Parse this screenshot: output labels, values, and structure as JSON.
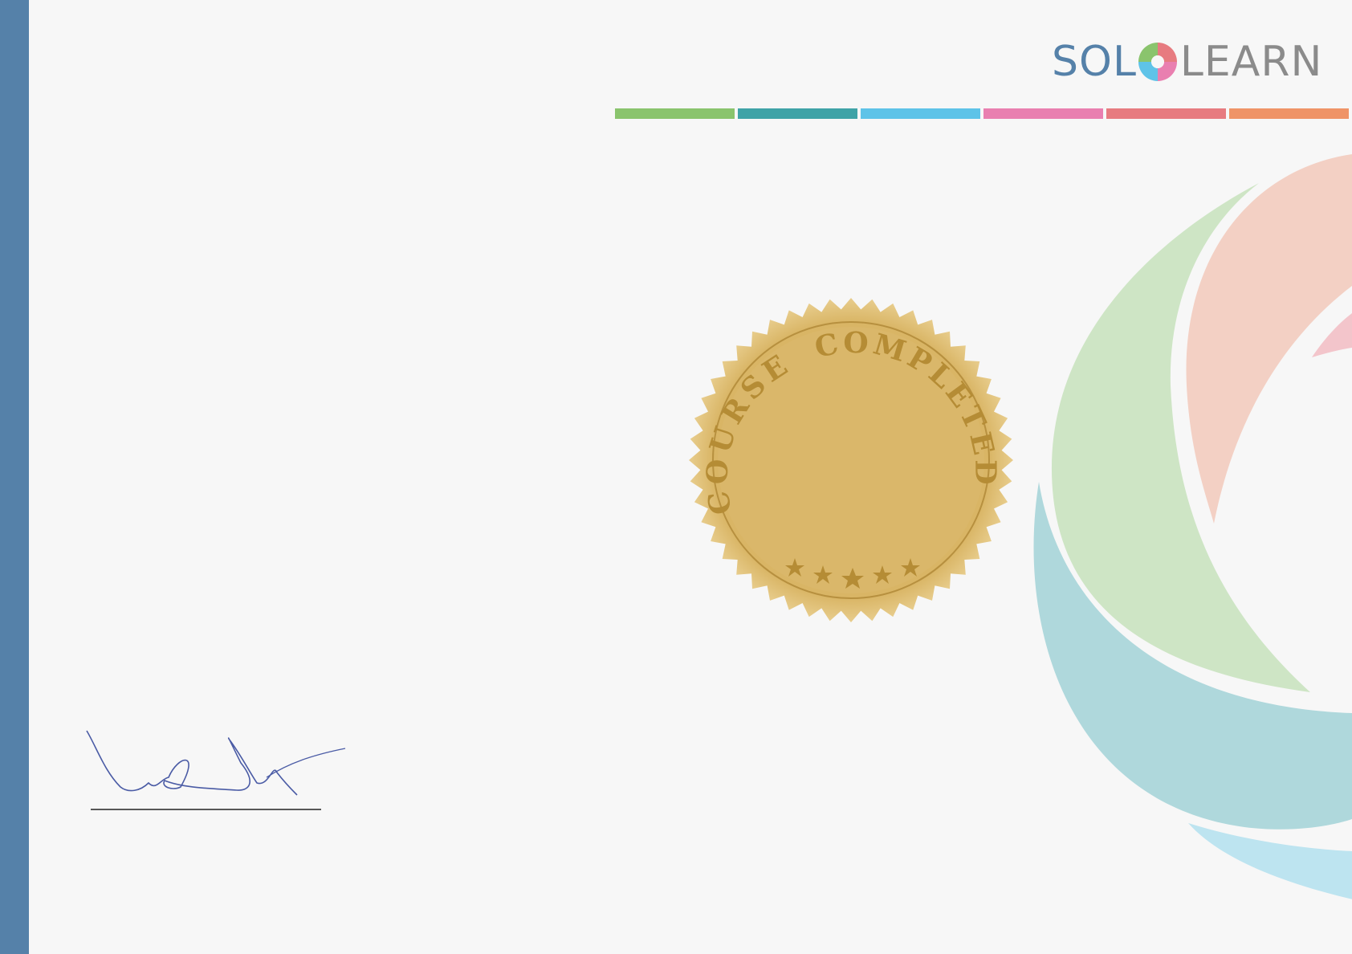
{
  "brand": {
    "logo_part1": "SOL",
    "logo_part2": "LEARN",
    "logo_text": "SOLOLEARN",
    "primary_color": "#5581a9",
    "secondary_color": "#8b8b8b"
  },
  "color_strip": [
    "#8ac46d",
    "#3fa3a7",
    "#5ec3e8",
    "#e97fb0",
    "#e77b80",
    "#ef9467"
  ],
  "seal": {
    "arc_text_left": "COURSE",
    "arc_text_right": "COMPLETED",
    "stars": 5,
    "color": "#d9b565"
  },
  "signature": {
    "icon": "handwritten-signature"
  }
}
